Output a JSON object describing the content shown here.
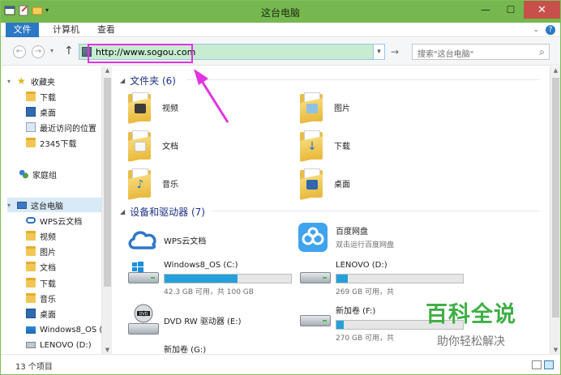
{
  "window": {
    "title": "这台电脑"
  },
  "ribbon": {
    "tabs": [
      "文件",
      "计算机",
      "查看"
    ]
  },
  "address": {
    "value": "http://www.sogou.com"
  },
  "search": {
    "placeholder": "搜索\"这台电脑\""
  },
  "sidebar": {
    "items": [
      {
        "label": "收藏夹",
        "icon": "star-icon"
      },
      {
        "label": "下载",
        "icon": "folder-icon"
      },
      {
        "label": "桌面",
        "icon": "desktop-icon"
      },
      {
        "label": "最近访问的位置",
        "icon": "recent-icon"
      },
      {
        "label": "2345下载",
        "icon": "folder-icon"
      },
      {
        "label": "家庭组",
        "icon": "homegroup-icon"
      },
      {
        "label": "这台电脑",
        "icon": "computer-icon"
      },
      {
        "label": "WPS云文档",
        "icon": "cloud-icon"
      },
      {
        "label": "视频",
        "icon": "folder-icon"
      },
      {
        "label": "图片",
        "icon": "folder-icon"
      },
      {
        "label": "文档",
        "icon": "folder-icon"
      },
      {
        "label": "下载",
        "icon": "folder-icon"
      },
      {
        "label": "音乐",
        "icon": "folder-icon"
      },
      {
        "label": "桌面",
        "icon": "desktop-icon"
      },
      {
        "label": "Windows8_OS (",
        "icon": "windows-drive-icon"
      },
      {
        "label": "LENOVO (D:)",
        "icon": "drive-icon"
      }
    ]
  },
  "folders": {
    "header": "文件夹 (6)",
    "items": [
      "视频",
      "图片",
      "文档",
      "下载",
      "音乐",
      "桌面"
    ]
  },
  "devices": {
    "header": "设备和驱动器 (7)",
    "apps": [
      {
        "name": "WPS云文档",
        "sub": ""
      },
      {
        "name": "百度网盘",
        "sub": "双击运行百度网盘"
      }
    ],
    "drives": [
      {
        "name": "Windows8_OS (C:)",
        "size": "42.3 GB 可用，共 100 GB",
        "used_fraction": 0.58
      },
      {
        "name": "LENOVO (D:)",
        "size": "269 GB 可用，共",
        "used_fraction": 0.09
      },
      {
        "name": "DVD RW 驱动器 (E:)",
        "size": "",
        "used_fraction": null
      },
      {
        "name": "新加卷 (F:)",
        "size": "270 GB 可用，共",
        "used_fraction": 0.06
      },
      {
        "name": "新加卷 (G:)",
        "size": "",
        "used_fraction": null
      }
    ]
  },
  "status": {
    "count": "13 个项目"
  },
  "watermark": {
    "title": "百科全说",
    "subtitle": "助你轻松解决"
  },
  "colors": {
    "titlebar": "#76b84f",
    "accent": "#2b78c5",
    "annotation": "#e134e0",
    "drive_fill": "#26a0da"
  }
}
